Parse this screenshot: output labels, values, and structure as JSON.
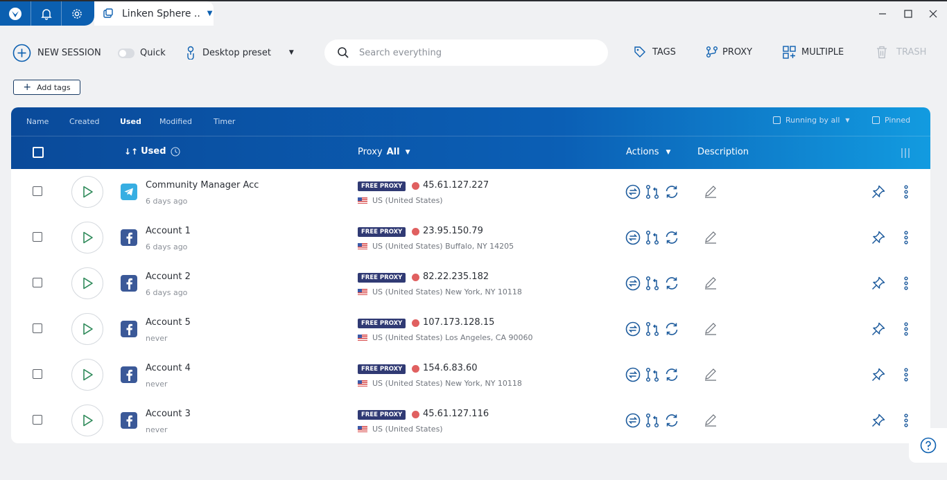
{
  "window": {
    "tab_title": "Linken Sphere ..",
    "app_tabs": [
      "logo-icon",
      "bell-icon",
      "gear-icon"
    ]
  },
  "toolbar": {
    "new_session": "NEW SESSION",
    "quick": "Quick",
    "preset": "Desktop preset",
    "search_placeholder": "Search everything",
    "tags": "TAGS",
    "proxy": "PROXY",
    "multiple": "MULTIPLE",
    "trash": "TRASH",
    "add_tags": "Add tags"
  },
  "table": {
    "sort_tabs": [
      "Name",
      "Created",
      "Used",
      "Modified",
      "Timer"
    ],
    "active_sort": "Used",
    "running_by_all": "Running by all",
    "pinned": "Pinned",
    "columns": {
      "used": "Used",
      "proxy": "Proxy",
      "proxy_filter": "All",
      "actions": "Actions",
      "description": "Description"
    },
    "rows": [
      {
        "name": "Community Manager Acc",
        "used": "6 days ago",
        "app": "telegram",
        "badge": "FREE PROXY",
        "ip": "45.61.127.227",
        "location": "US (United States)"
      },
      {
        "name": "Account 1",
        "used": "6 days ago",
        "app": "facebook",
        "badge": "FREE PROXY",
        "ip": "23.95.150.79",
        "location": "US (United States) Buffalo, NY 14205"
      },
      {
        "name": "Account 2",
        "used": "6 days ago",
        "app": "facebook",
        "badge": "FREE PROXY",
        "ip": "82.22.235.182",
        "location": "US (United States) New York, NY 10118"
      },
      {
        "name": "Account 5",
        "used": "never",
        "app": "facebook",
        "badge": "FREE PROXY",
        "ip": "107.173.128.15",
        "location": "US (United States) Los Angeles, CA 90060"
      },
      {
        "name": "Account 4",
        "used": "never",
        "app": "facebook",
        "badge": "FREE PROXY",
        "ip": "154.6.83.60",
        "location": "US (United States) New York, NY 10118"
      },
      {
        "name": "Account 3",
        "used": "never",
        "app": "facebook",
        "badge": "FREE PROXY",
        "ip": "45.61.127.116",
        "location": "US (United States)"
      }
    ]
  },
  "colors": {
    "brand_blue": "#0b5fb0",
    "proxy_badge": "#303a74",
    "status_dot": "#e06060",
    "action_icon": "#1c5a9c",
    "play_icon": "#2f8a5a"
  }
}
